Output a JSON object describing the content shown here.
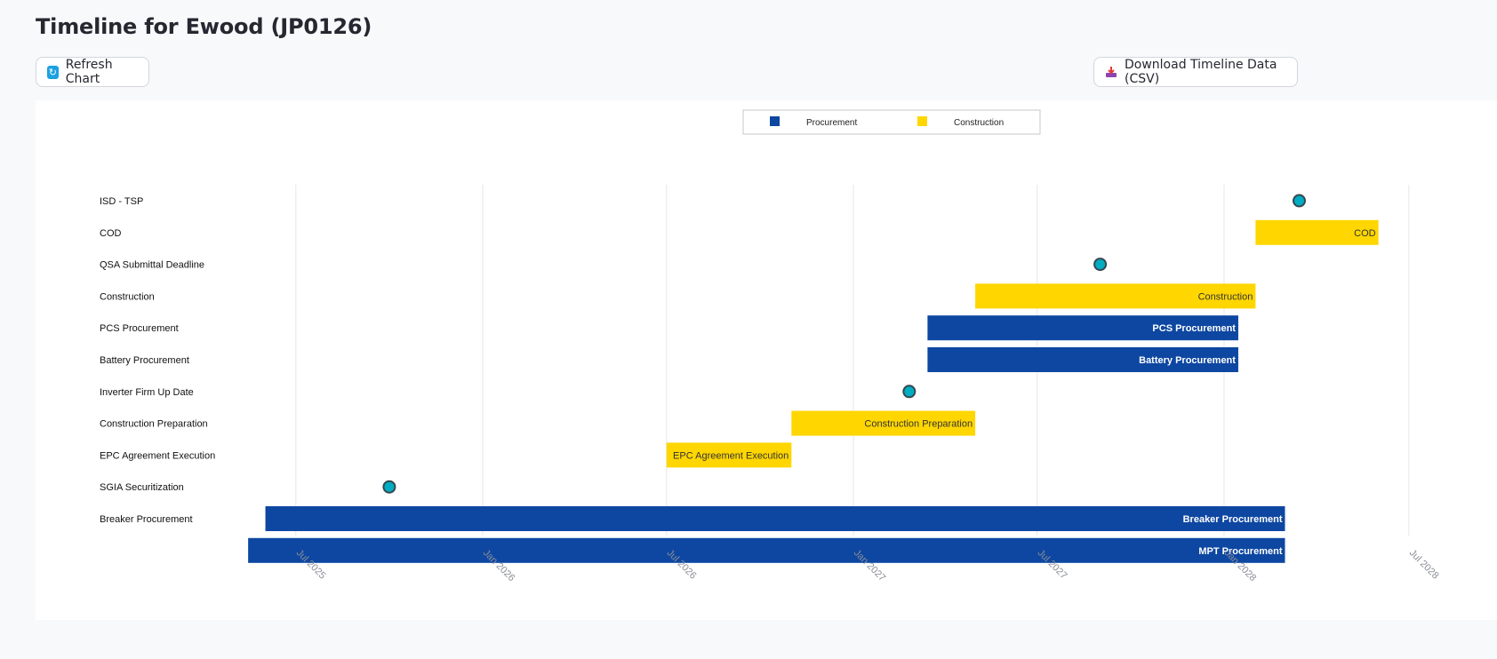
{
  "page": {
    "title": "Timeline for Ewood (JP0126)"
  },
  "toolbar": {
    "refresh_label": "Refresh Chart",
    "download_label": "Download Timeline Data (CSV)",
    "refresh_icon": "refresh-icon",
    "download_icon": "download-icon"
  },
  "chart_data": {
    "type": "gantt",
    "legend": [
      {
        "name": "Procurement",
        "color": "#0d47a1"
      },
      {
        "name": "Construction",
        "color": "#ffd600"
      }
    ],
    "legend_placement": "top-center",
    "milestone_color": "#00acc1",
    "x_ticks": [
      "Jul 2025",
      "Jan 2026",
      "Jul 2026",
      "Jan 2027",
      "Jul 2027",
      "Jan 2028",
      "Jul 2028"
    ],
    "x_tick_dates": [
      "2025-07-01",
      "2026-01-01",
      "2026-07-01",
      "2027-01-01",
      "2027-07-01",
      "2028-01-01",
      "2028-07-01"
    ],
    "xlim": [
      "2025-04-09",
      "2028-08-20"
    ],
    "grid": "vertical",
    "rows": [
      {
        "label": "ISD - TSP",
        "kind": "milestone",
        "date": "2028-03-15"
      },
      {
        "label": "COD",
        "kind": "bar",
        "category": "Construction",
        "start": "2028-02-01",
        "end": "2028-06-01",
        "bar_label": "COD"
      },
      {
        "label": "QSA Submittal   Deadline",
        "kind": "milestone",
        "date": "2027-09-01"
      },
      {
        "label": "Construction",
        "kind": "bar",
        "category": "Construction",
        "start": "2027-05-01",
        "end": "2028-02-01",
        "bar_label": "Construction"
      },
      {
        "label": "PCS   Procurement",
        "kind": "bar",
        "category": "Procurement",
        "start": "2027-03-15",
        "end": "2028-01-15",
        "bar_label": "PCS   Procurement"
      },
      {
        "label": "Battery   Procurement",
        "kind": "bar",
        "category": "Procurement",
        "start": "2027-03-15",
        "end": "2028-01-15",
        "bar_label": "Battery   Procurement"
      },
      {
        "label": "Inverter Firm   Up Date",
        "kind": "milestone",
        "date": "2027-02-25"
      },
      {
        "label": "Construction   Preparation",
        "kind": "bar",
        "category": "Construction",
        "start": "2026-11-01",
        "end": "2027-05-01",
        "bar_label": "Construction   Preparation"
      },
      {
        "label": "EPC Agreement   Execution",
        "kind": "bar",
        "category": "Construction",
        "start": "2026-07-01",
        "end": "2026-11-01",
        "bar_label": "EPC Agreement   Execution"
      },
      {
        "label": "SGIA   Securitization",
        "kind": "milestone",
        "date": "2025-10-01"
      },
      {
        "label": "Breaker   Procurement",
        "kind": "bar",
        "category": "Procurement",
        "start": "2025-06-01",
        "end": "2028-03-01",
        "bar_label": "Breaker   Procurement"
      },
      {
        "label": "",
        "kind": "bar",
        "category": "Procurement",
        "start": "2025-05-15",
        "end": "2028-03-01",
        "bar_label": "MPT   Procurement"
      }
    ]
  }
}
